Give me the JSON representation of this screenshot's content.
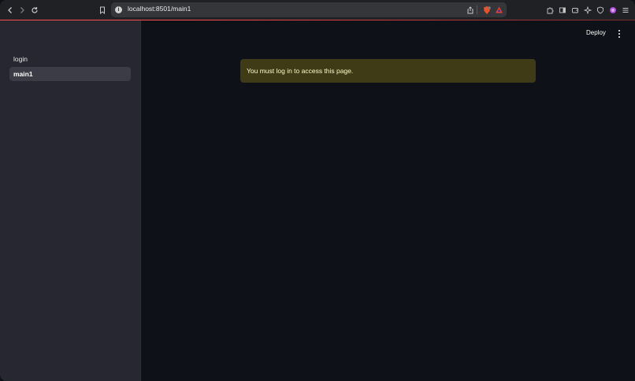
{
  "browser": {
    "url": "localhost:8501/main1",
    "icons": {
      "back": "chevron-left-icon",
      "forward": "chevron-right-icon",
      "reload": "reload-icon",
      "bookmark": "bookmark-icon",
      "site_info": "info-icon",
      "share": "share-icon",
      "brave_shields": "brave-shield-icon",
      "brave_rewards": "brave-rewards-icon",
      "extensions": "puzzle-icon",
      "sidebar": "sidebar-icon",
      "wallet": "wallet-icon",
      "leo": "leo-icon",
      "vpn": "vpn-icon",
      "profile": "profile-icon",
      "menu": "hamburger-menu-icon"
    },
    "accent_color": "#ff4b4b"
  },
  "sidebar": {
    "items": [
      {
        "label": "login",
        "active": false
      },
      {
        "label": "main1",
        "active": true
      }
    ]
  },
  "header": {
    "deploy_label": "Deploy"
  },
  "main": {
    "warning_text": "You must log in to access this page.",
    "warning_color": "#3e3b16"
  }
}
